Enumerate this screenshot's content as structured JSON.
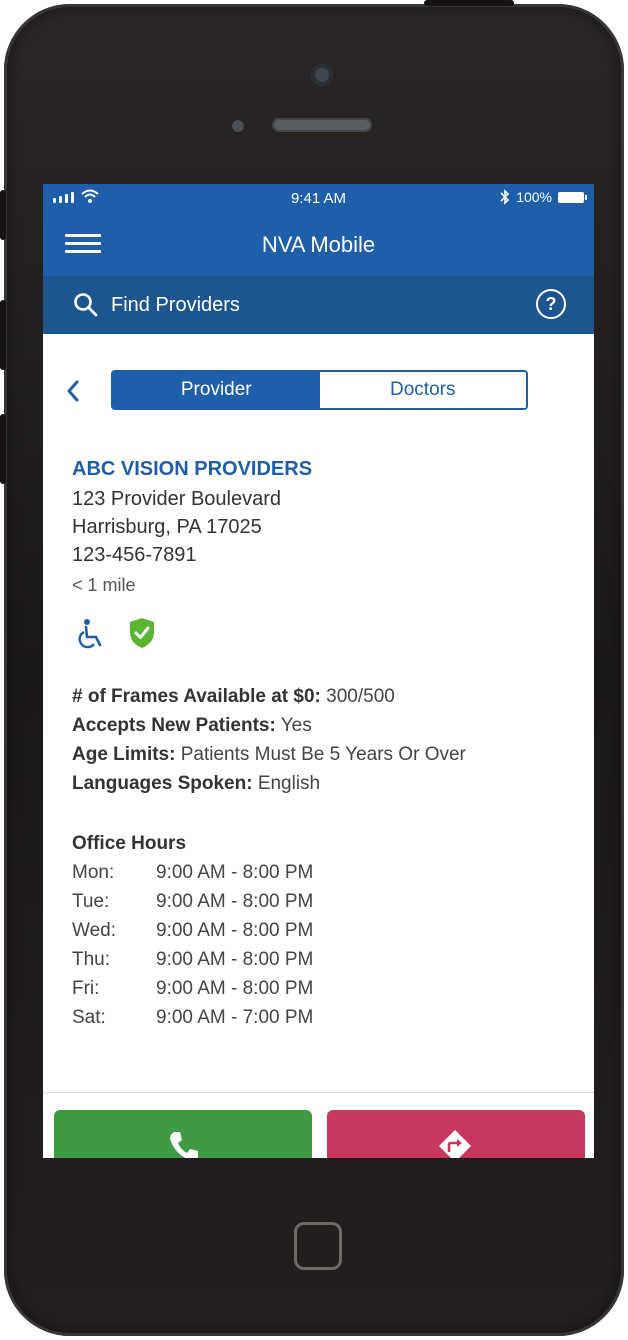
{
  "status_bar": {
    "time": "9:41 AM",
    "battery": "100%"
  },
  "header": {
    "title": "NVA Mobile"
  },
  "search": {
    "label": "Find Providers"
  },
  "tabs": [
    {
      "label": "Provider",
      "active": true
    },
    {
      "label": "Doctors",
      "active": false
    }
  ],
  "provider": {
    "name": "ABC VISION PROVIDERS",
    "address_line1": "123 Provider Boulevard",
    "address_line2": "Harrisburg, PA 17025",
    "phone": "123-456-7891",
    "distance": "< 1 mile"
  },
  "details": [
    {
      "label": "# of Frames Available at $0:",
      "value": "300/500"
    },
    {
      "label": "Accepts New Patients:",
      "value": "Yes"
    },
    {
      "label": "Age Limits:",
      "value": "Patients Must Be 5 Years Or Over"
    },
    {
      "label": "Languages Spoken:",
      "value": "English"
    }
  ],
  "office_hours": {
    "title": "Office Hours",
    "rows": [
      {
        "day": "Mon:",
        "hours": "9:00 AM - 8:00 PM"
      },
      {
        "day": "Tue:",
        "hours": "9:00 AM - 8:00 PM"
      },
      {
        "day": "Wed:",
        "hours": "9:00 AM - 8:00 PM"
      },
      {
        "day": "Thu:",
        "hours": "9:00 AM - 8:00 PM"
      },
      {
        "day": "Fri:",
        "hours": "9:00 AM - 8:00 PM"
      },
      {
        "day": "Sat:",
        "hours": "9:00 AM - 7:00 PM"
      }
    ]
  },
  "actions": {
    "call_color": "#3f9b43",
    "directions_color": "#c8375e"
  },
  "colors": {
    "brand": "#1f5ea8",
    "accent_green": "#5cb531"
  },
  "icons": [
    "menu-icon",
    "search-icon",
    "help-icon",
    "back-icon",
    "wheelchair-icon",
    "shield-check-icon",
    "phone-icon",
    "directions-icon"
  ]
}
